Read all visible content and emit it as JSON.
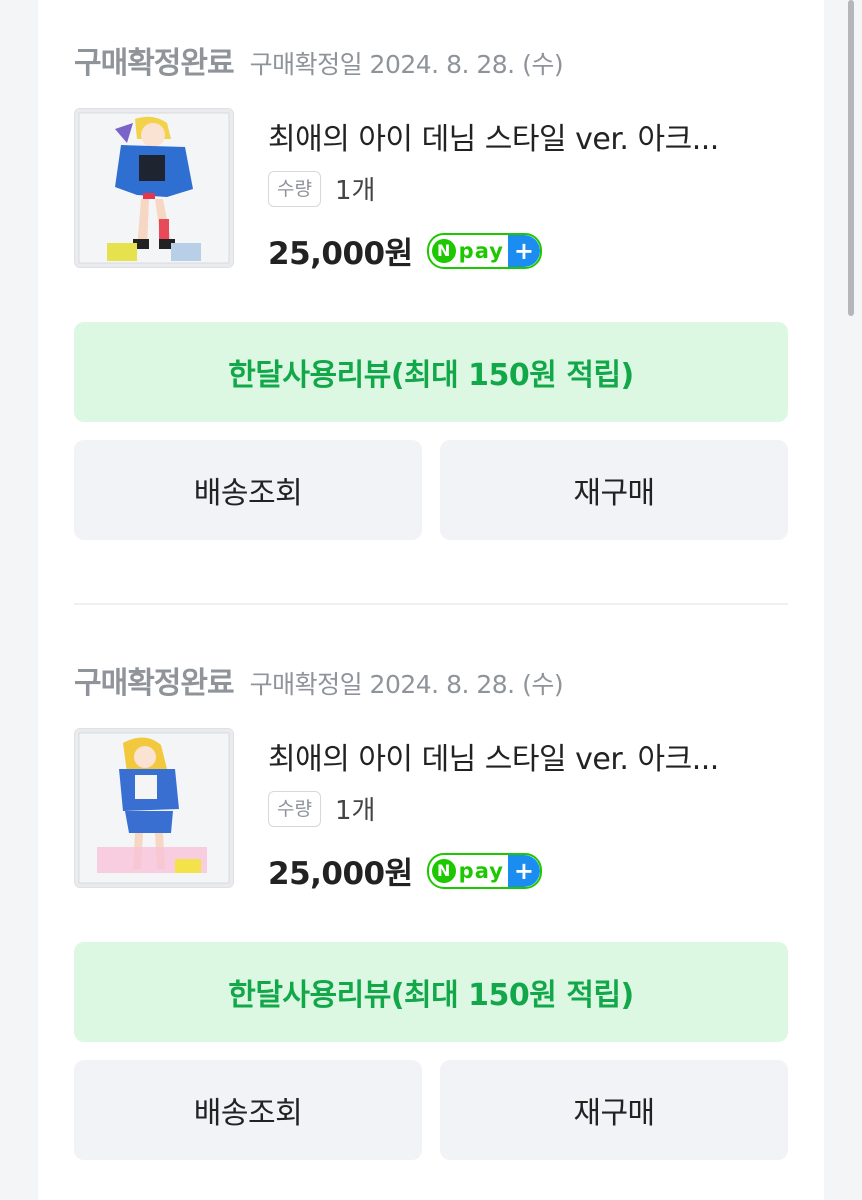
{
  "orders": [
    {
      "status": "구매확정완료",
      "date": "구매확정일 2024. 8. 28. (수)",
      "product_name": "최애의 아이 데님 스타일 ver. 아크...",
      "qty_label": "수량",
      "qty_value": "1개",
      "price": "25,000원",
      "npay_n": "N",
      "npay_text": "pay",
      "npay_plus": "+",
      "review_label": "한달사용리뷰(최대 150원 적립)",
      "shipping_label": "배송조회",
      "rebuy_label": "재구매"
    },
    {
      "status": "구매확정완료",
      "date": "구매확정일 2024. 8. 28. (수)",
      "product_name": "최애의 아이 데님 스타일 ver. 아크...",
      "qty_label": "수량",
      "qty_value": "1개",
      "price": "25,000원",
      "npay_n": "N",
      "npay_text": "pay",
      "npay_plus": "+",
      "review_label": "한달사용리뷰(최대 150원 적립)",
      "shipping_label": "배송조회",
      "rebuy_label": "재구매"
    }
  ],
  "colors": {
    "review_bg": "#dcf8e3",
    "review_text": "#12a84a",
    "npay_green": "#1ec800",
    "npay_blue": "#1b8cf0"
  }
}
